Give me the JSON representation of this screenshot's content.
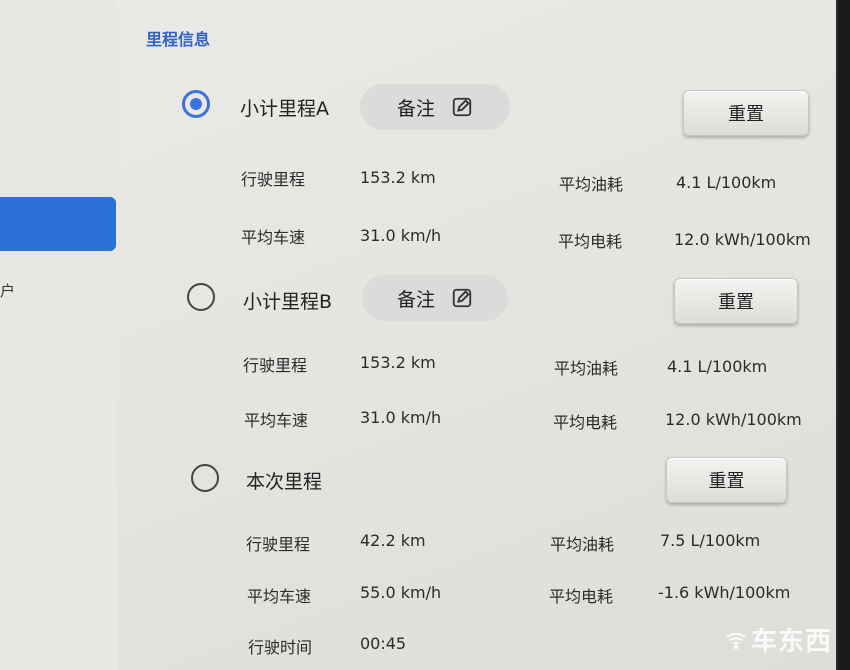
{
  "section_title": "里程信息",
  "sidebar": {
    "partial_label": "户"
  },
  "trip_a": {
    "title": "小计里程A",
    "note_label": "备注",
    "reset_label": "重置",
    "stats": {
      "distance_label": "行驶里程",
      "distance_value": "153.2 km",
      "fuel_label": "平均油耗",
      "fuel_value": "4.1 L/100km",
      "speed_label": "平均车速",
      "speed_value": "31.0 km/h",
      "power_label": "平均电耗",
      "power_value": "12.0 kWh/100km"
    }
  },
  "trip_b": {
    "title": "小计里程B",
    "note_label": "备注",
    "reset_label": "重置",
    "stats": {
      "distance_label": "行驶里程",
      "distance_value": "153.2 km",
      "fuel_label": "平均油耗",
      "fuel_value": "4.1 L/100km",
      "speed_label": "平均车速",
      "speed_value": "31.0 km/h",
      "power_label": "平均电耗",
      "power_value": "12.0 kWh/100km"
    }
  },
  "current_trip": {
    "title": "本次里程",
    "reset_label": "重置",
    "stats": {
      "distance_label": "行驶里程",
      "distance_value": "42.2 km",
      "fuel_label": "平均油耗",
      "fuel_value": "7.5 L/100km",
      "speed_label": "平均车速",
      "speed_value": "55.0 km/h",
      "power_label": "平均电耗",
      "power_value": "-1.6 kWh/100km",
      "time_label": "行驶时间",
      "time_value": "00:45"
    }
  },
  "watermark": "车东西",
  "colors": {
    "accent": "#3a74df",
    "title": "#2f62c6"
  },
  "icons": {
    "edit": "edit-icon",
    "radio_on": "radio-selected",
    "radio_off": "radio-unselected"
  }
}
